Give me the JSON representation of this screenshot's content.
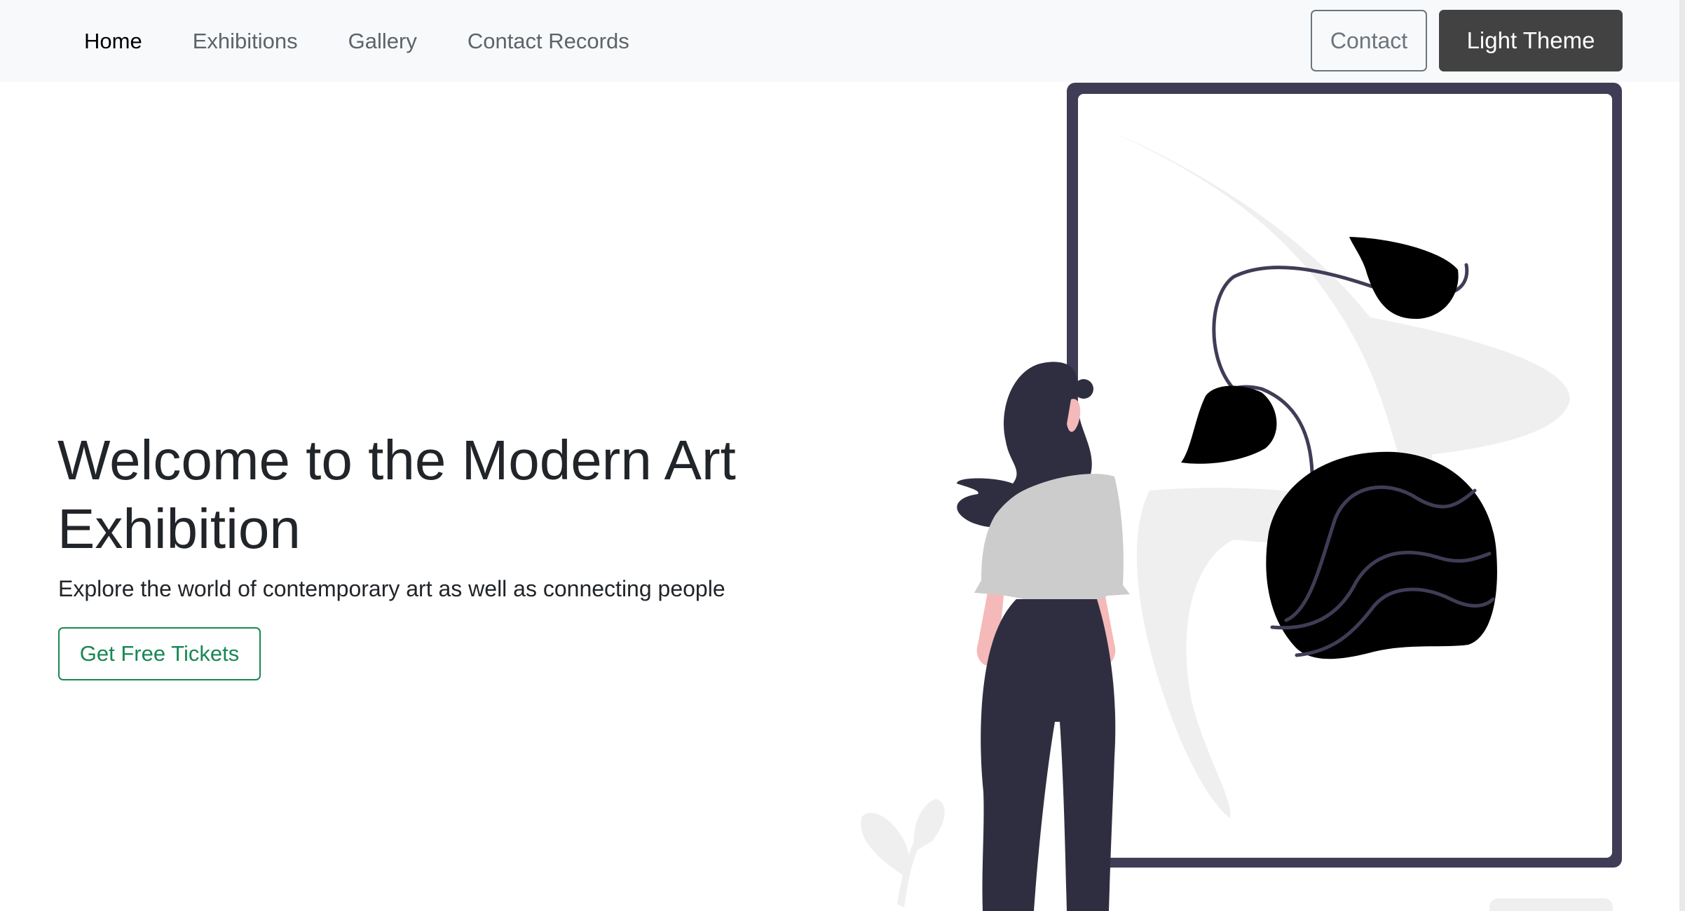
{
  "navbar": {
    "links": [
      {
        "label": "Home",
        "active": true
      },
      {
        "label": "Exhibitions",
        "active": false
      },
      {
        "label": "Gallery",
        "active": false
      },
      {
        "label": "Contact Records",
        "active": false
      }
    ],
    "contact_button": "Contact",
    "theme_button": "Light Theme"
  },
  "hero": {
    "title": "Welcome to the Modern Art Exhibition",
    "subtitle": "Explore the world of contemporary art as well as connecting people",
    "cta_button": "Get Free Tickets"
  },
  "colors": {
    "navbar_bg": "#f8f9fa",
    "accent_green": "#198754",
    "theme_button_bg": "#424242",
    "frame": "#3f3d56",
    "figure_dark": "#2f2e41",
    "skin": "#f4b9b8",
    "shirt": "#cccccc"
  },
  "illustration": {
    "icon": "woman-viewing-art-illustration"
  }
}
